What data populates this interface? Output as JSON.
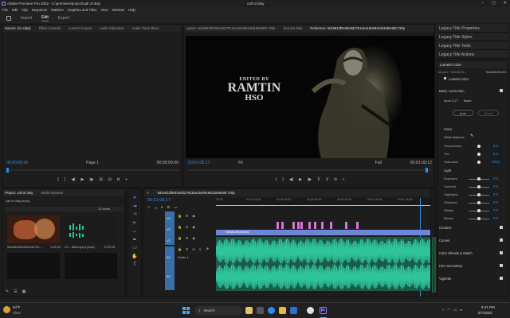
{
  "app": {
    "title": "Adobe Premiere Pro 2022 - C:\\premiere\\project\\call of duty",
    "doc_title": "call of duty"
  },
  "menu": [
    "File",
    "Edit",
    "Clip",
    "Sequence",
    "Markers",
    "Graphics and Titles",
    "View",
    "Window",
    "Help"
  ],
  "workspaces": {
    "import": "Import",
    "edit": "Edit",
    "export": "Export"
  },
  "source": {
    "tabs": [
      "Source: (no clips)",
      "Effect Controls",
      "Lumetri Scopes",
      "Audio Clip Mixer",
      "Audio Track Mixer"
    ],
    "tc_left": "00;00;00;00",
    "page": "Page 1",
    "tc_right": "00;00;00;00"
  },
  "program": {
    "tabs": [
      "ogram: 9dc5813f9c92e0d27913ea15e09c94d1566488.720p",
      "Text (no title)",
      "Reference: 9dc5813f9c92e0d27913ea15e09c94d1566488.720p"
    ],
    "tc_left": "00;01;08;17",
    "fit": "Fit",
    "full": "Full",
    "tc_right": "00;01;09;12",
    "overlay1": "EDITED BY",
    "overlay2": "RAMTIN",
    "overlay3": "HSO"
  },
  "project": {
    "tabs": [
      "Project: call of duty",
      "Media Browser"
    ],
    "bin": "call of duty.prproj",
    "items_count": "12 items",
    "items": [
      {
        "name": "9dc5813f9c92e0d2791…",
        "dur": "1;09;12"
      },
      {
        "name": "C1 - Mihooya (Lyrics)",
        "dur": "2;03;16"
      }
    ]
  },
  "timeline": {
    "tab": "9dc5813f9c92e0d27913ea15e09c94d1566488.720p",
    "tc": "00;01;08;17",
    "ruler": [
      "00;00",
      "00;00;16;00",
      "00;00;32;00",
      "00;00;48;00",
      "00;01;04;00",
      "00;01;20;00",
      "00;01;36;00"
    ],
    "video_clip": "9dc5813f9c92e0d2",
    "tracks": {
      "v3": "V3",
      "v2": "V2",
      "v1": "V1",
      "a1": "A1",
      "a2": "A2",
      "audio1": "Audio 1"
    }
  },
  "panels": {
    "legacy": [
      "Legacy Title Properties",
      "Legacy Title Styles",
      "Legacy Title Tools",
      "Legacy Title Actions"
    ],
    "lumetri": "Lumetri Color",
    "master": "Master * 9dc5813f...",
    "clip": "9dc5813f9c92…",
    "lumetri_dd": "Lumetri Color",
    "basic": "Basic Correction",
    "input_lut": "Input LUT",
    "input_lut_val": "None",
    "auto": "Auto",
    "reset": "Reset",
    "color": "Color",
    "wb": "White Balance",
    "light": "Light"
  },
  "lumetri_rows": [
    {
      "label": "Temperature",
      "val": "0.0"
    },
    {
      "label": "Tint",
      "val": "0.0"
    },
    {
      "label": "Saturation",
      "val": "100.0"
    },
    {
      "label": "Exposure",
      "val": "0.0"
    },
    {
      "label": "Contrast",
      "val": "0.0"
    },
    {
      "label": "Highlights",
      "val": "0.0"
    },
    {
      "label": "Shadows",
      "val": "0.0"
    },
    {
      "label": "Whites",
      "val": "0.0"
    },
    {
      "label": "Blacks",
      "val": "0.0"
    }
  ],
  "sections": [
    "Creative",
    "Curves",
    "Color Wheels & Match",
    "HSL Secondary",
    "Vignette"
  ],
  "taskbar": {
    "temp": "84°F",
    "weather": "Clear",
    "search": "Search",
    "time": "8:41 PM",
    "date": "8/7/2023",
    "lang": "ENG"
  },
  "colors": {
    "accent": "#2d8ceb",
    "audio": "#2fc39a",
    "video_clip": "#6e86d6",
    "marker": "#d873d8"
  }
}
